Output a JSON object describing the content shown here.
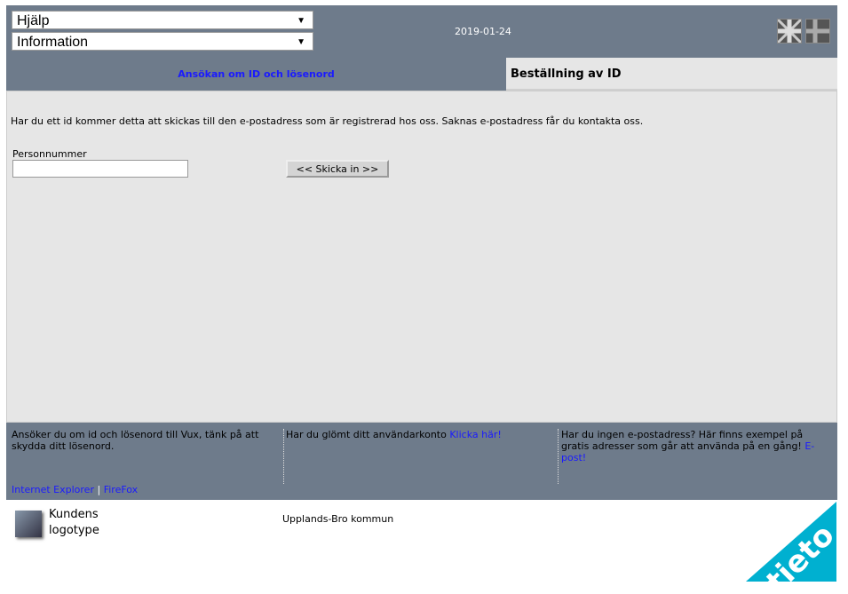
{
  "header": {
    "select_help": "Hjälp",
    "select_info": "Information",
    "date": "2019-01-24"
  },
  "tabs": [
    {
      "label": "Ansökan om ID och lösenord"
    },
    {
      "label": "Beställning av ID"
    }
  ],
  "main": {
    "intro": "Har du ett id kommer detta att skickas till den e-postadress som är registrerad hos oss. Saknas e-postadress får du kontakta oss.",
    "personnummer_label": "Personnummer",
    "personnummer_value": "",
    "submit_label": "<< Skicka in >>"
  },
  "footer": {
    "col1": "Ansöker du om id och lösenord till Vux, tänk på att skydda ditt lösenord.",
    "col2": "Har du glömt ditt användarkonto ",
    "col2_link": "Klicka här!",
    "col3": "Har du ingen e-postadress? Här finns exempel på gratis adresser som går att använda på en gång! ",
    "col3_link": "E-post!",
    "link_ie": "Internet Explorer",
    "sep": "|",
    "link_ff": "FireFox"
  },
  "bottom": {
    "logo_text_1": "Kundens",
    "logo_text_2": "logotype",
    "municipality": "Upplands-Bro kommun",
    "brand": "tieto"
  },
  "colors": {
    "header_bg": "#6e7b8b",
    "link": "#1a1aff",
    "tieto": "#00b0d0"
  }
}
